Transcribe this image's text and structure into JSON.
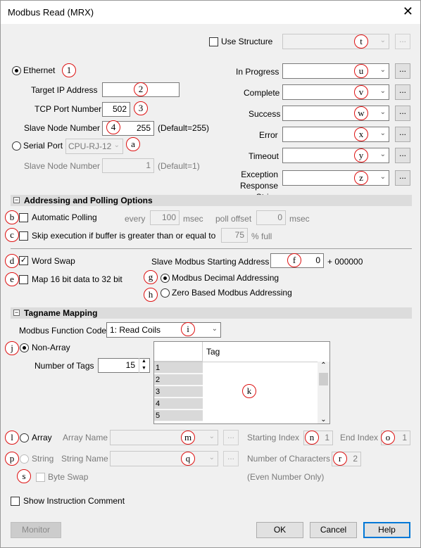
{
  "window": {
    "title": "Modbus Read (MRX)",
    "close": "✕"
  },
  "structure": {
    "label": "Use Structure",
    "callout": "t"
  },
  "ethernet": {
    "label": "Ethernet",
    "callout": "1",
    "target_ip_label": "Target IP Address",
    "target_ip_callout": "2",
    "target_ip_value": "",
    "tcp_port_label": "TCP Port Number",
    "tcp_port_value": "502",
    "tcp_port_callout": "3",
    "slave_node_label": "Slave Node Number",
    "slave_node_callout": "4",
    "slave_node_value": "255",
    "slave_node_default": "(Default=255)"
  },
  "serial": {
    "label": "Serial Port",
    "port_value": "CPU-RJ-12",
    "callout": "a",
    "slave_node_label": "Slave Node Number",
    "slave_node_value": "1",
    "slave_node_default": "(Default=1)"
  },
  "status_fields": [
    {
      "label": "In Progress",
      "callout": "u"
    },
    {
      "label": "Complete",
      "callout": "v"
    },
    {
      "label": "Success",
      "callout": "w"
    },
    {
      "label": "Error",
      "callout": "x"
    },
    {
      "label": "Timeout",
      "callout": "y"
    },
    {
      "label": "Exception\nResponse String",
      "callout": "z"
    }
  ],
  "dots": "...",
  "addressing": {
    "title": "Addressing and Polling Options",
    "auto_poll_callout": "b",
    "auto_poll_label": "Automatic Polling",
    "every_label": "every",
    "every_value": "100",
    "msec": "msec",
    "poll_offset_label": "poll offset",
    "poll_offset_value": "0",
    "skip_callout": "c",
    "skip_label": "Skip execution if buffer is greater than or equal to",
    "skip_value": "75",
    "skip_unit": "% full",
    "word_swap_callout": "d",
    "word_swap_label": "Word Swap",
    "slave_start_label": "Slave Modbus Starting Address",
    "slave_start_callout": "f",
    "slave_start_value": "0",
    "slave_start_suffix": "+ 000000",
    "map_callout": "e",
    "map_label": "Map 16 bit data to 32 bit",
    "decimal_callout": "g",
    "decimal_label": "Modbus Decimal Addressing",
    "zero_callout": "h",
    "zero_label": "Zero Based Modbus Addressing"
  },
  "tagname": {
    "title": "Tagname Mapping",
    "func_label": "Modbus Function Code",
    "func_value": "1: Read Coils",
    "func_callout": "i",
    "nonarray_callout": "j",
    "nonarray_label": "Non-Array",
    "num_tags_label": "Number of Tags",
    "num_tags_value": "15",
    "grid_header": "Tag",
    "grid_callout": "k",
    "rows": [
      "1",
      "2",
      "3",
      "4",
      "5"
    ],
    "array_callout": "l",
    "array_label": "Array",
    "array_name_label": "Array Name",
    "array_name_callout": "m",
    "start_index_label": "Starting Index",
    "start_index_callout": "n",
    "start_index_value": "1",
    "end_index_label": "End Index",
    "end_index_callout": "o",
    "end_index_value": "1",
    "string_callout": "p",
    "string_label": "String",
    "string_name_label": "String Name",
    "string_name_callout": "q",
    "num_chars_label": "Number of Characters",
    "num_chars_callout": "r",
    "num_chars_value": "2",
    "byte_swap_callout": "s",
    "byte_swap_label": "Byte Swap",
    "even_only": "(Even Number Only)"
  },
  "footer": {
    "show_comment_label": "Show Instruction Comment",
    "monitor": "Monitor",
    "ok": "OK",
    "cancel": "Cancel",
    "help": "Help"
  }
}
